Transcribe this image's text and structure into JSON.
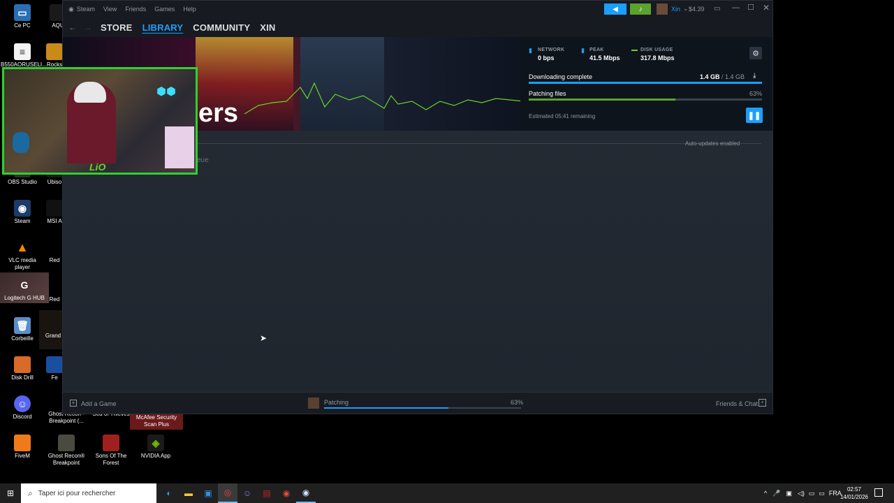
{
  "desktop": {
    "icons": [
      {
        "label": "Ce PC",
        "glyph": "🖥"
      },
      {
        "label": "AQU",
        "glyph": ""
      },
      {
        "label": "B550AORUSELI...",
        "glyph": "📄"
      },
      {
        "label": "Rocks",
        "glyph": ""
      },
      {
        "label": "OBS Studio",
        "glyph": ""
      },
      {
        "label": "Ubiso",
        "glyph": ""
      },
      {
        "label": "Steam",
        "glyph": ""
      },
      {
        "label": "MSI A",
        "glyph": ""
      },
      {
        "label": "VLC media player",
        "glyph": "▲"
      },
      {
        "label": "Red",
        "glyph": ""
      },
      {
        "label": "Logitech G HUB",
        "glyph": "G"
      },
      {
        "label": "Red",
        "glyph": ""
      },
      {
        "label": "Corbeille",
        "glyph": "🗑"
      },
      {
        "label": "Grand",
        "glyph": ""
      },
      {
        "label": "Disk Drill",
        "glyph": ""
      },
      {
        "label": "Fe",
        "glyph": ""
      },
      {
        "label": "Discord",
        "glyph": ""
      },
      {
        "label": "Ghost Recon - Breakpoint (...",
        "glyph": ""
      },
      {
        "label": "Sea of Thieves",
        "glyph": ""
      },
      {
        "label": "McAfee Security Scan Plus",
        "glyph": ""
      },
      {
        "label": "FiveM",
        "glyph": ""
      },
      {
        "label": "Ghost Recon® Breakpoint",
        "glyph": ""
      },
      {
        "label": "Sons Of The Forest",
        "glyph": ""
      },
      {
        "label": "NVIDIA App",
        "glyph": ""
      }
    ]
  },
  "steam": {
    "titlebar": {
      "menu": [
        "Steam",
        "View",
        "Friends",
        "Games",
        "Help"
      ],
      "username": "Xin",
      "balance": "$4.39"
    },
    "nav": {
      "tabs": [
        "STORE",
        "LIBRARY",
        "COMMUNITY",
        "XIN"
      ],
      "active": "LIBRARY"
    },
    "banner": {
      "partial_title": "ers"
    },
    "stats": {
      "network_label": "NETWORK",
      "network_value": "0 bps",
      "peak_label": "PEAK",
      "peak_value": "41.5 Mbps",
      "disk_label": "DISK USAGE",
      "disk_value": "317.8 Mbps",
      "download_label": "Downloading complete",
      "download_size": "1.4 GB",
      "download_total": "1.4 GB",
      "download_progress": 1.0,
      "patch_label": "Patching files",
      "patch_percent": "63%",
      "patch_progress": 0.63,
      "remaining": "Estimated 05:41 remaining"
    },
    "main": {
      "auto_updates": "Auto-updates enabled",
      "partial_queue": "eue"
    },
    "bottombar": {
      "add_game": "Add a Game",
      "status": "Patching",
      "status_percent": "63%",
      "status_progress": 0.63,
      "friends_chat": "Friends & Chat"
    },
    "colors": {
      "accent": "#1a9fff",
      "progress_green": "#5ba32b",
      "announce": "#1a9fff",
      "notify": "#5ba32b"
    }
  },
  "webcam": {
    "overlay_text": "LiO"
  },
  "taskbar": {
    "search_placeholder": "Taper ici pour rechercher",
    "language": "FRA",
    "time": "02:57",
    "date": "14/01/2026"
  }
}
